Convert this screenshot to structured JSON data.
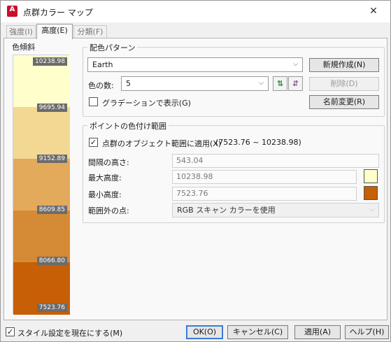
{
  "window": {
    "title": "点群カラー マップ",
    "close_glyph": "✕",
    "app_icon_letter": "A"
  },
  "tabs": [
    {
      "label": "強度(I)"
    },
    {
      "label": "高度(E)"
    },
    {
      "label": "分類(F)"
    }
  ],
  "legend": {
    "title": "色傾斜",
    "bands": [
      {
        "label": "10238.98",
        "color": "#ffffcc"
      },
      {
        "label": "9695.94",
        "color": "#f3d894"
      },
      {
        "label": "9152.89",
        "color": "#e3aa5c"
      },
      {
        "label": "8609.85",
        "color": "#d58b35"
      },
      {
        "label": "8066.80",
        "color": "#c65f06"
      },
      {
        "label": "7523.76",
        "color": "#c65f06"
      }
    ]
  },
  "scheme": {
    "group_title": "配色パターン",
    "selected": "Earth",
    "color_count_label": "色の数:",
    "color_count_value": "5",
    "gradient_label": "グラデーションで表示(G)",
    "gradient_checked": false,
    "new_button": "新規作成(N)",
    "delete_button": "削除(D)",
    "rename_button": "名前変更(R)"
  },
  "range": {
    "group_title": "ポイントの色付け範囲",
    "apply_label": "点群のオブジェクト範囲に適用(X)",
    "apply_range_text": "(7523.76 ~ 10238.98)",
    "apply_checked": true,
    "interval_label": "間隔の高さ:",
    "interval_value": "543.04",
    "max_label": "最大高度:",
    "max_value": "10238.98",
    "max_color": "#ffffcc",
    "min_label": "最小高度:",
    "min_value": "7523.76",
    "min_color": "#c65f06",
    "outside_label": "範囲外の点:",
    "outside_value": "RGB スキャン カラーを使用"
  },
  "footer": {
    "current_style_label": "スタイル設定を現在にする(M)",
    "current_style_checked": true,
    "ok": "OK(O)",
    "cancel": "キャンセル(C)",
    "apply": "適用(A)",
    "help": "ヘルプ(H)"
  }
}
